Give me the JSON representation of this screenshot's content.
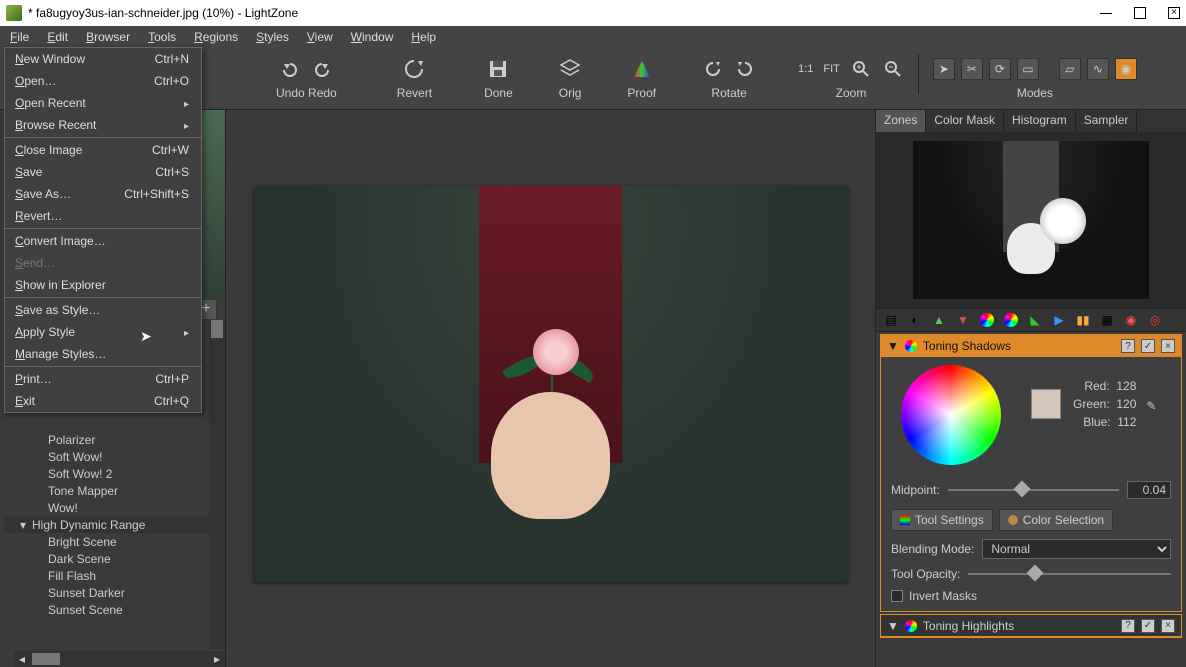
{
  "window": {
    "title": "* fa8ugyoy3us-ian-schneider.jpg (10%) - LightZone"
  },
  "menubar": [
    "File",
    "Edit",
    "Browser",
    "Tools",
    "Regions",
    "Styles",
    "View",
    "Window",
    "Help"
  ],
  "file_menu": [
    {
      "label": "New Window",
      "accel": "Ctrl+N"
    },
    {
      "label": "Open…",
      "accel": "Ctrl+O"
    },
    {
      "label": "Open Recent",
      "sub": true
    },
    {
      "label": "Browse Recent",
      "sub": true
    },
    "-",
    {
      "label": "Close Image",
      "accel": "Ctrl+W"
    },
    {
      "label": "Save",
      "accel": "Ctrl+S"
    },
    {
      "label": "Save As…",
      "accel": "Ctrl+Shift+S"
    },
    {
      "label": "Revert…"
    },
    "-",
    {
      "label": "Convert Image…"
    },
    {
      "label": "Send…",
      "disabled": true
    },
    {
      "label": "Show in Explorer"
    },
    "-",
    {
      "label": "Save as Style…"
    },
    {
      "label": "Apply Style",
      "sub": true
    },
    {
      "label": "Manage Styles…"
    },
    "-",
    {
      "label": "Print…",
      "accel": "Ctrl+P"
    },
    {
      "label": "Exit",
      "accel": "Ctrl+Q"
    }
  ],
  "toolbar": {
    "undo_redo": "Undo Redo",
    "revert": "Revert",
    "done": "Done",
    "orig": "Orig",
    "proof": "Proof",
    "rotate": "Rotate",
    "zoom": "Zoom",
    "fit": "FIT",
    "one_to_one": "1:1",
    "modes": "Modes"
  },
  "styles_tree": {
    "items": [
      "Polarizer",
      "Soft Wow!",
      "Soft Wow! 2",
      "Tone Mapper",
      "Wow!"
    ],
    "group": "High Dynamic Range",
    "group_items": [
      "Bright Scene",
      "Dark Scene",
      "Fill Flash",
      "Sunset Darker",
      "Sunset Scene"
    ]
  },
  "right": {
    "tabs": [
      "Zones",
      "Color Mask",
      "Histogram",
      "Sampler"
    ],
    "active_tab": "Zones",
    "toning_shadows": {
      "title": "Toning Shadows",
      "red_label": "Red:",
      "red_value": "128",
      "green_label": "Green:",
      "green_value": "120",
      "blue_label": "Blue:",
      "blue_value": "112",
      "midpoint_label": "Midpoint:",
      "midpoint_value": "0.04",
      "tool_settings": "Tool Settings",
      "color_selection": "Color Selection",
      "blending_label": "Blending Mode:",
      "blending_value": "Normal",
      "opacity_label": "Tool Opacity:",
      "invert_label": "Invert Masks"
    },
    "toning_highlights": {
      "title": "Toning Highlights"
    }
  }
}
